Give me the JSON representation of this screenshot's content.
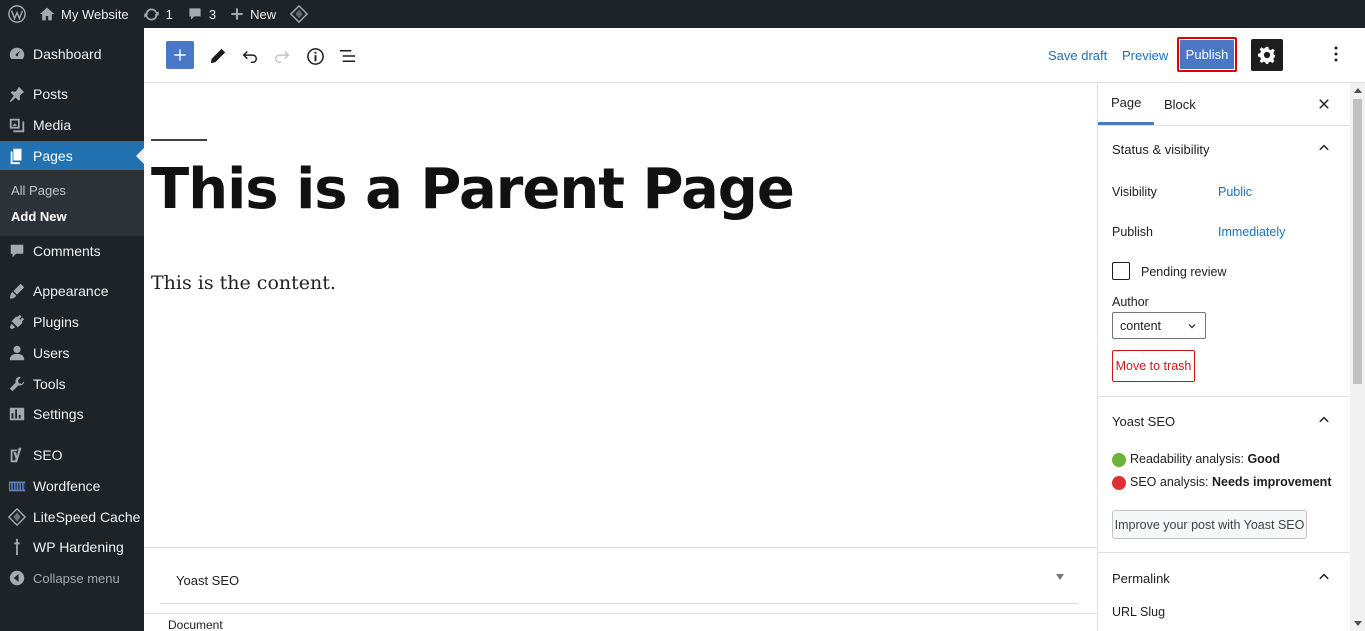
{
  "adminbar": {
    "site_name": "My Website",
    "updates_count": "1",
    "comments_count": "3",
    "new_label": "New"
  },
  "sidebar": {
    "items": [
      {
        "label": "Dashboard",
        "icon": "dashboard-icon"
      },
      {
        "label": "Posts",
        "icon": "pin-icon"
      },
      {
        "label": "Media",
        "icon": "media-icon"
      },
      {
        "label": "Pages",
        "icon": "pages-icon"
      },
      {
        "label": "Comments",
        "icon": "comment-icon"
      },
      {
        "label": "Appearance",
        "icon": "brush-icon"
      },
      {
        "label": "Plugins",
        "icon": "plugin-icon"
      },
      {
        "label": "Users",
        "icon": "user-icon"
      },
      {
        "label": "Tools",
        "icon": "wrench-icon"
      },
      {
        "label": "Settings",
        "icon": "settings-icon"
      },
      {
        "label": "SEO",
        "icon": "yoast-icon"
      },
      {
        "label": "Wordfence",
        "icon": "wordfence-icon"
      },
      {
        "label": "LiteSpeed Cache",
        "icon": "litespeed-icon"
      },
      {
        "label": "WP Hardening",
        "icon": "hardening-icon"
      }
    ],
    "submenu": [
      "All Pages",
      "Add New"
    ],
    "collapse_label": "Collapse menu"
  },
  "toolbar": {
    "save_draft": "Save draft",
    "preview": "Preview",
    "publish": "Publish"
  },
  "editor": {
    "title": "This is a Parent Page",
    "content": "This is the content."
  },
  "metabox": {
    "yoast_label": "Yoast SEO",
    "footer_breadcrumb": "Document"
  },
  "panel": {
    "tabs": [
      "Page",
      "Block"
    ],
    "status_title": "Status & visibility",
    "visibility_label": "Visibility",
    "visibility_value": "Public",
    "publish_label": "Publish",
    "publish_value": "Immediately",
    "pending_label": "Pending review",
    "author_label": "Author",
    "author_value": "content",
    "trash_label": "Move to trash",
    "yoast_title": "Yoast SEO",
    "readability_label": "Readability analysis:",
    "readability_value": "Good",
    "seo_label": "SEO analysis:",
    "seo_value": "Needs improvement",
    "improve_label": "Improve your post with Yoast SEO",
    "permalink_title": "Permalink",
    "url_slug_label": "URL Slug"
  },
  "colors": {
    "admin_dark": "#1d2327",
    "accent": "#4a78c7",
    "highlight_border": "#e00000",
    "trash_red": "#cc1818"
  }
}
